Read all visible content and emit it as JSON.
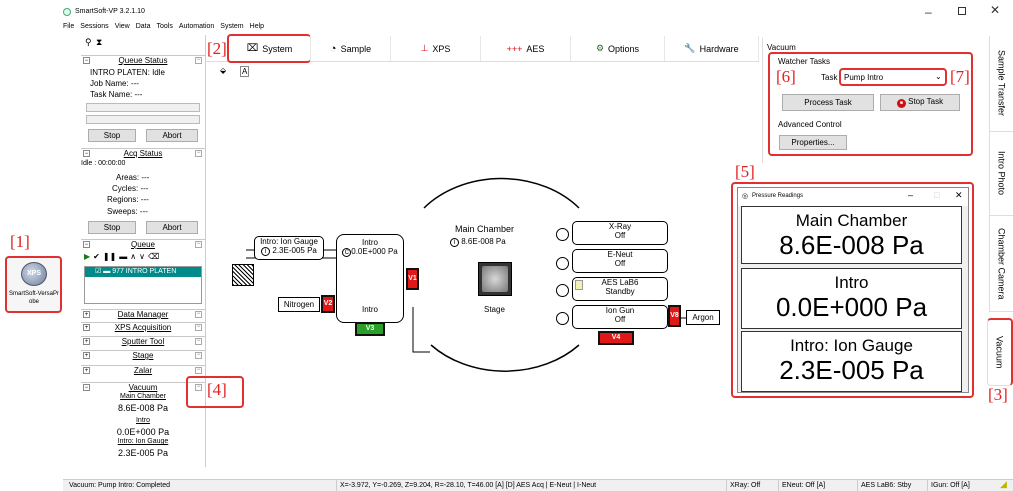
{
  "window": {
    "title": "SmartSoft-VP 3.2.1.10"
  },
  "menu": [
    "File",
    "Sessions",
    "View",
    "Data",
    "Tools",
    "Automation",
    "System",
    "Help"
  ],
  "desktop_icon": {
    "label": "SmartSoft-VersaProbe",
    "glyph": "XPS"
  },
  "annotations": [
    "[1]",
    "[2]",
    "[3]",
    "[4]",
    "[5]",
    "[6]",
    "[7]"
  ],
  "left_panel": {
    "queue_status": {
      "title": "Queue Status",
      "lines": [
        "INTRO PLATEN: Idle",
        "Job Name: ---",
        "Task Name: ---"
      ],
      "stop": "Stop",
      "abort": "Abort"
    },
    "acq_status": {
      "title": "Acq Status",
      "time": "Idle : 00:00:00",
      "areas": "Areas: ---",
      "cycles": "Cycles: ---",
      "regions": "Regions: ---",
      "sweeps": "Sweeps: ---",
      "stop": "Stop",
      "abort": "Abort"
    },
    "queue": {
      "title": "Queue",
      "item": "977 INTRO PLATEN"
    },
    "sections": [
      "Data Manager",
      "XPS Acquisition",
      "Sputter Tool",
      "Stage",
      "Zalar"
    ],
    "vacuum": {
      "title": "Vacuum",
      "readings": [
        {
          "name": "Main Chamber",
          "value": "8.6E-008 Pa"
        },
        {
          "name": "Intro",
          "value": "0.0E+000 Pa"
        },
        {
          "name": "Intro: Ion Gauge",
          "value": "2.3E-005 Pa"
        }
      ]
    }
  },
  "tabs": [
    {
      "label": "System",
      "icon": "system-icon"
    },
    {
      "label": "Sample",
      "icon": "sample-icon"
    },
    {
      "label": "XPS",
      "icon": "xps-icon"
    },
    {
      "label": "AES",
      "icon": "aes-icon"
    },
    {
      "label": "Options",
      "icon": "options-icon"
    },
    {
      "label": "Hardware",
      "icon": "hardware-icon"
    }
  ],
  "diagram": {
    "intro_gauge": {
      "name": "Intro: Ion Gauge",
      "value": "2.3E-005 Pa",
      "marker": "I"
    },
    "intro_reading": {
      "name": "Intro",
      "value": "0.0E+000 Pa",
      "marker": "C"
    },
    "intro_label": "Intro",
    "nitrogen": "Nitrogen",
    "main_chamber": {
      "name": "Main Chamber",
      "value": "8.6E-008 Pa",
      "marker": "I"
    },
    "stage": "Stage",
    "xray": {
      "name": "X-Ray",
      "state": "Off"
    },
    "eneut": {
      "name": "E-Neut",
      "state": "Off"
    },
    "aes": {
      "name": "AES LaB6",
      "state": "Standby"
    },
    "iongun": {
      "name": "Ion Gun",
      "state": "Off"
    },
    "argon": "Argon",
    "valves": {
      "v1": "V1",
      "v2": "V2",
      "v3": "V3",
      "v4": "V4",
      "v8": "V8"
    }
  },
  "vacuum_panel": {
    "title": "Vacuum",
    "watcher_tasks": "Watcher Tasks",
    "task_label": "Task",
    "task_value": "Pump Intro",
    "process_task": "Process Task",
    "stop_task": "Stop Task",
    "advanced_control": "Advanced Control",
    "properties": "Properties..."
  },
  "pressure_window": {
    "title": "Pressure Readings",
    "readings": [
      {
        "name": "Main Chamber",
        "value": "8.6E-008 Pa"
      },
      {
        "name": "Intro",
        "value": "0.0E+000 Pa"
      },
      {
        "name": "Intro: Ion Gauge",
        "value": "2.3E-005 Pa"
      }
    ]
  },
  "side_tabs": [
    "Sample Transfer",
    "Intro Photo",
    "Chamber Camera",
    "Vacuum"
  ],
  "status_bar": {
    "message": "Vacuum: Pump Intro: Completed",
    "coords": "X=-3.972, Y=-0.269, Z=9.204, R=-28.10, T=46.00 [A] [D]  AES Acq | E-Neut | I-Neut",
    "xray": "XRay: Off",
    "eneut": "ENeut: Off [A]",
    "aes": "AES LaB6: Stby",
    "igun": "IGun: Off [A]"
  },
  "colors": {
    "annotation": "#e03030",
    "valve_closed": "#e01818",
    "valve_open": "#2aa02a",
    "queue_selected": "#008b8b"
  }
}
